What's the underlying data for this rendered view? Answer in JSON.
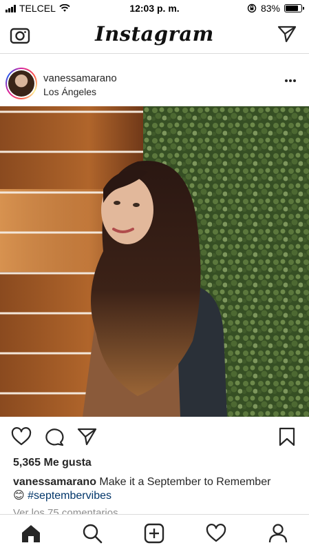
{
  "status_bar": {
    "carrier": "TELCEL",
    "time": "12:03 p. m.",
    "battery_text": "83%",
    "battery_level": 0.83
  },
  "header": {
    "logo_text": "Instagram",
    "icons": [
      "camera-icon",
      "direct-message-icon"
    ]
  },
  "post": {
    "username": "vanessamarano",
    "location": "Los Ángeles",
    "likes": "5,365 Me gusta",
    "caption_user": "vanessamarano",
    "caption_text": "Make it a September to Remember",
    "caption_emoji": "😊",
    "hashtag": "#septembervibes",
    "comments_link": "Ver los 75 comentarios"
  },
  "actions": [
    "heart-icon",
    "comment-icon",
    "share-icon",
    "bookmark-icon"
  ],
  "bottom_nav": [
    "home-icon",
    "search-icon",
    "add-post-icon",
    "activity-heart-icon",
    "profile-icon"
  ],
  "colors": {
    "text": "#262626",
    "hashtag": "#003569",
    "muted": "#8e8e8e",
    "divider": "#dbdbdb"
  }
}
